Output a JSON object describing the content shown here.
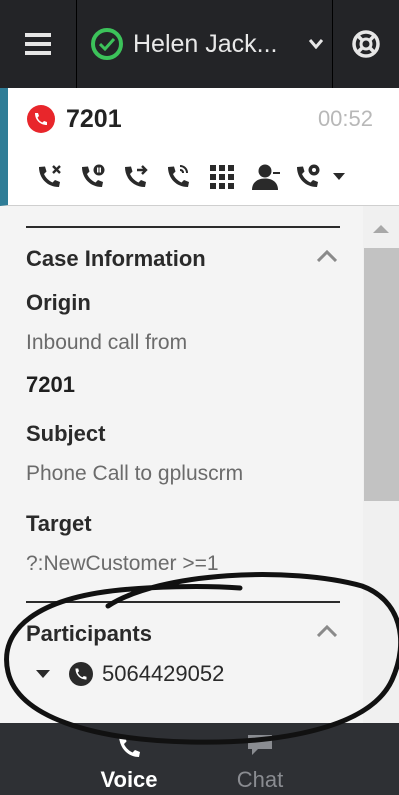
{
  "header": {
    "menu_icon": "hamburger-icon",
    "agent_status_icon": "check-circle-icon",
    "agent_name": "Helen Jack...",
    "agent_dropdown_icon": "chevron-down-icon",
    "support_icon": "lifebuoy-icon",
    "status_color": "#3cc25a"
  },
  "call": {
    "number": "7201",
    "timer": "00:52",
    "state_color": "#e8262b",
    "accent_color": "#2f7d97",
    "actions": [
      {
        "icon": "end-call-icon"
      },
      {
        "icon": "hold-call-icon"
      },
      {
        "icon": "transfer-call-icon"
      },
      {
        "icon": "consult-call-icon"
      },
      {
        "icon": "dialpad-icon"
      },
      {
        "icon": "party-icon"
      },
      {
        "icon": "record-call-icon"
      }
    ]
  },
  "case_info": {
    "title": "Case Information",
    "origin_label": "Origin",
    "origin_value": "Inbound call from",
    "origin_number": "7201",
    "subject_label": "Subject",
    "subject_value": "Phone Call to gpluscrm",
    "target_label": "Target",
    "target_value": "?:NewCustomer >=1"
  },
  "participants": {
    "title": "Participants",
    "items": [
      {
        "number": "5064429052",
        "icon": "phone-call-icon"
      }
    ]
  },
  "tabs": [
    {
      "label": "Voice",
      "icon": "phone-icon",
      "active": true
    },
    {
      "label": "Chat",
      "icon": "chat-icon",
      "active": false
    }
  ]
}
